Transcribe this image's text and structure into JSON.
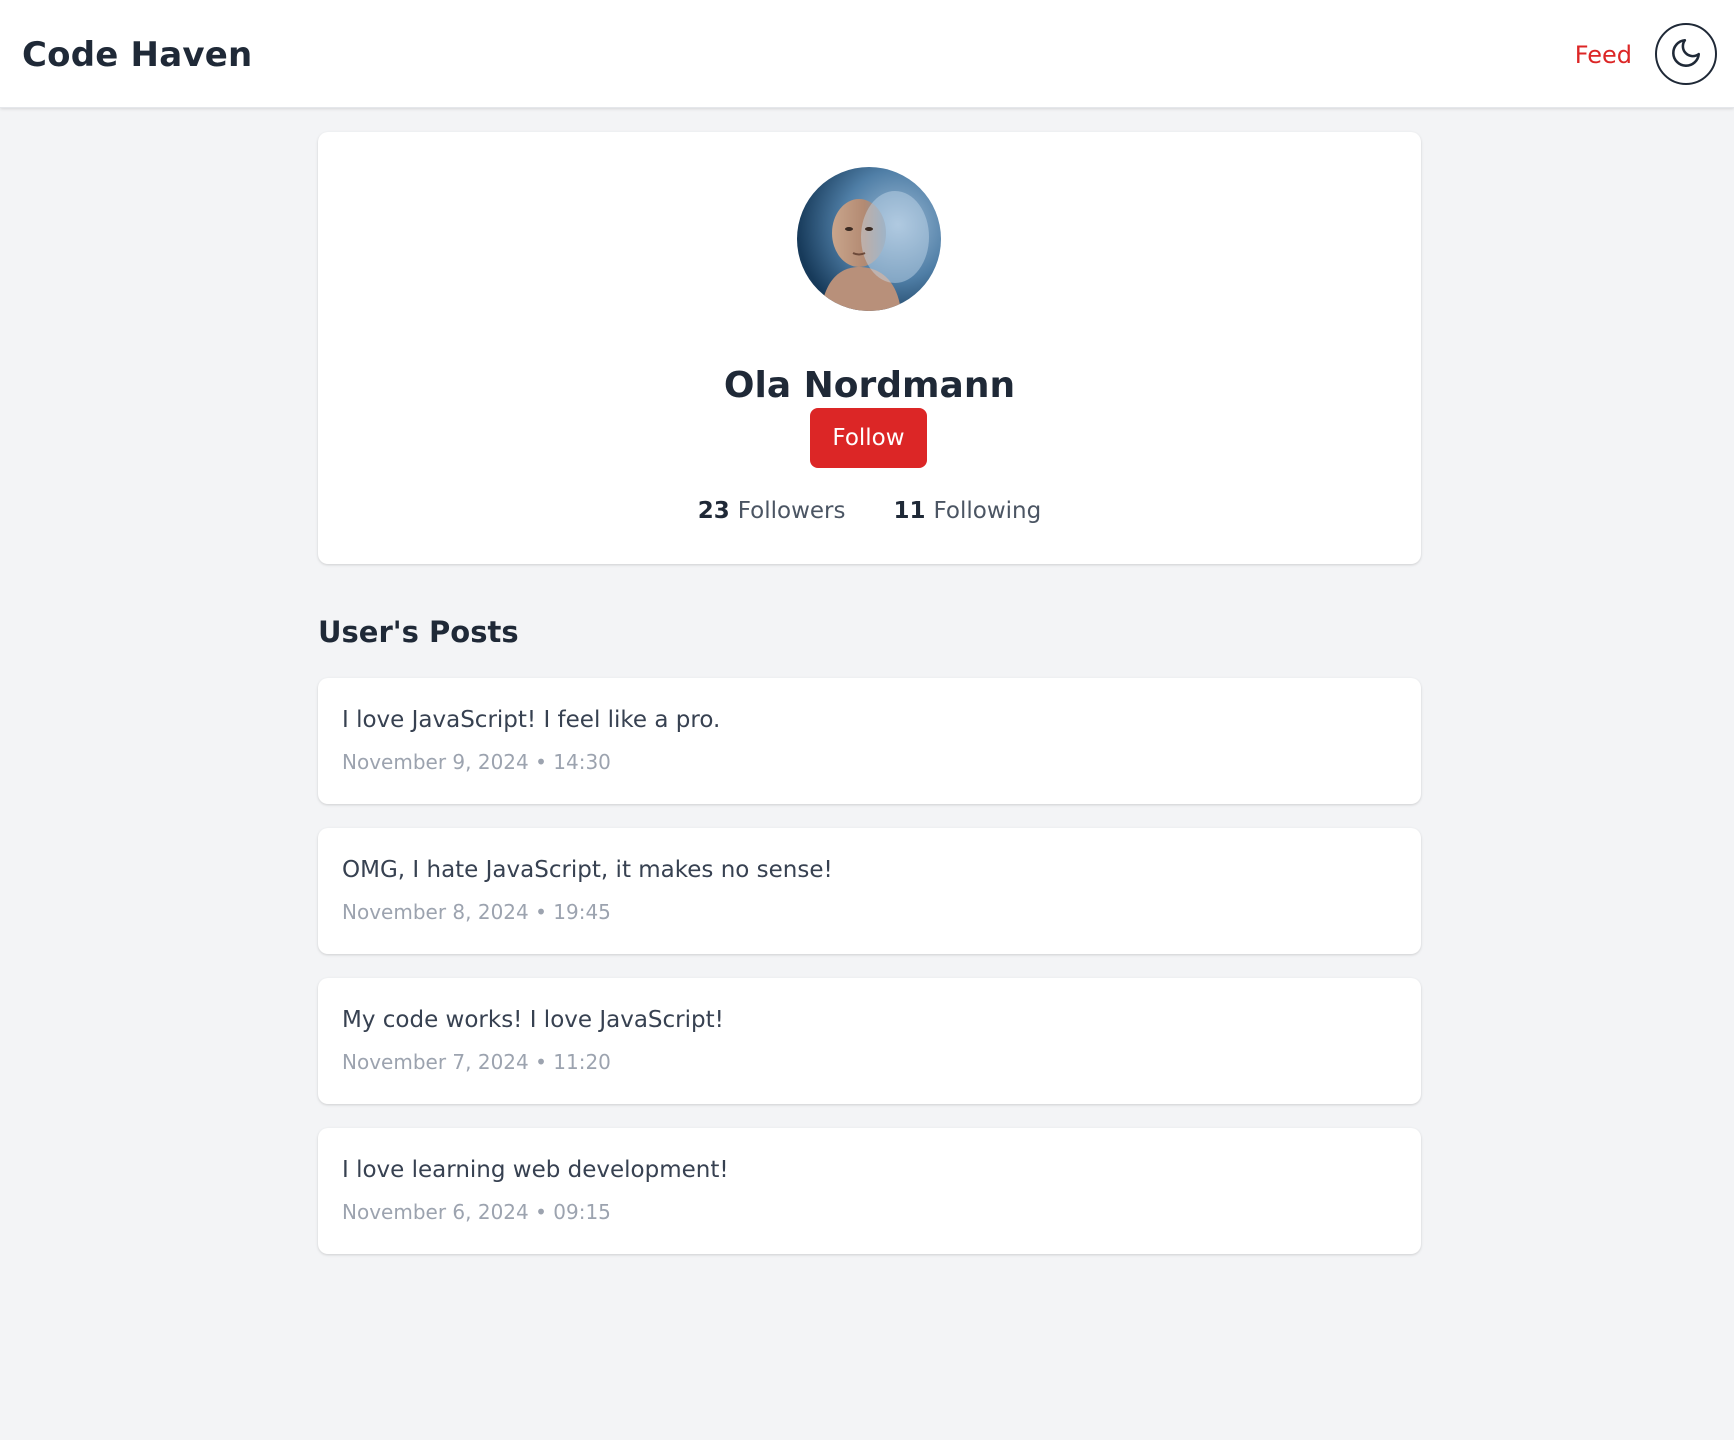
{
  "header": {
    "brand": "Code Haven",
    "nav_feed": "Feed",
    "theme_toggle_icon": "moon-icon"
  },
  "profile": {
    "name": "Ola Nordmann",
    "follow_label": "Follow",
    "followers_count": "23",
    "followers_label": "Followers",
    "following_count": "11",
    "following_label": "Following"
  },
  "posts_section": {
    "heading": "User's Posts",
    "posts": [
      {
        "content": "I love JavaScript! I feel like a pro.",
        "meta": "November 9, 2024 • 14:30"
      },
      {
        "content": "OMG, I hate JavaScript, it makes no sense!",
        "meta": "November 8, 2024 • 19:45"
      },
      {
        "content": "My code works! I love JavaScript!",
        "meta": "November 7, 2024 • 11:20"
      },
      {
        "content": "I love learning web development!",
        "meta": "November 6, 2024 • 09:15"
      }
    ]
  },
  "colors": {
    "accent": "#dc2626",
    "background": "#f3f4f6",
    "card": "#ffffff",
    "text_primary": "#1f2937",
    "text_muted": "#9ca3af"
  }
}
